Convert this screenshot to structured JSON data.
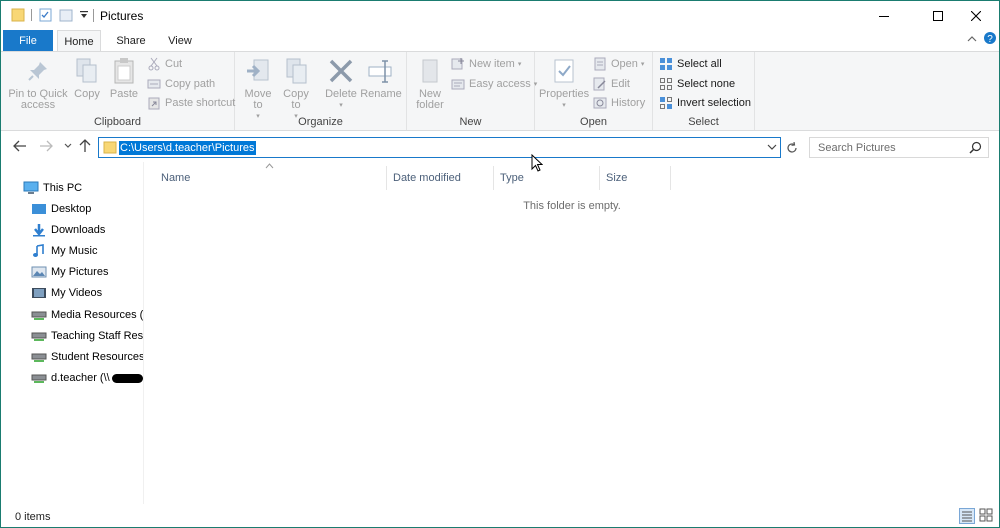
{
  "window": {
    "title": "Pictures",
    "colors": {
      "accent": "#1979ca",
      "frame": "#1a7c70",
      "ribbon_bg": "#f5f6f7",
      "selection": "#0078d7"
    }
  },
  "tabs": {
    "file": "File",
    "home": "Home",
    "share": "Share",
    "view": "View"
  },
  "ribbon": {
    "clipboard": {
      "label": "Clipboard",
      "pin": "Pin to Quick access",
      "copy": "Copy",
      "paste": "Paste",
      "cut": "Cut",
      "copy_path": "Copy path",
      "paste_shortcut": "Paste shortcut"
    },
    "organize": {
      "label": "Organize",
      "move_to": "Move to",
      "copy_to": "Copy to",
      "delete": "Delete",
      "rename": "Rename"
    },
    "new": {
      "label": "New",
      "new_folder": "New folder",
      "new_item": "New item",
      "easy_access": "Easy access"
    },
    "open": {
      "label": "Open",
      "properties": "Properties",
      "open": "Open",
      "edit": "Edit",
      "history": "History"
    },
    "select": {
      "label": "Select",
      "select_all": "Select all",
      "select_none": "Select none",
      "invert_selection": "Invert selection"
    }
  },
  "address": {
    "path": "C:\\Users\\d.teacher\\Pictures",
    "search_placeholder": "Search Pictures"
  },
  "nav_pane": {
    "items": [
      {
        "label": "This PC",
        "icon": "pc-icon"
      },
      {
        "label": "Desktop",
        "icon": "desktop-icon"
      },
      {
        "label": "Downloads",
        "icon": "downloads-icon"
      },
      {
        "label": "My Music",
        "icon": "music-icon"
      },
      {
        "label": "My Pictures",
        "icon": "pictures-icon"
      },
      {
        "label": "My Videos",
        "icon": "videos-icon"
      },
      {
        "label": "Media Resources (J:",
        "icon": "network-drive-icon"
      },
      {
        "label": "Teaching Staff Reso",
        "icon": "network-drive-icon"
      },
      {
        "label": "Student Resources (",
        "icon": "network-drive-icon"
      },
      {
        "label": "d.teacher (\\\\",
        "icon": "network-drive-icon"
      }
    ]
  },
  "columns": {
    "name": "Name",
    "date_modified": "Date modified",
    "type": "Type",
    "size": "Size"
  },
  "content": {
    "empty_message": "This folder is empty."
  },
  "status": {
    "items": "0 items"
  }
}
